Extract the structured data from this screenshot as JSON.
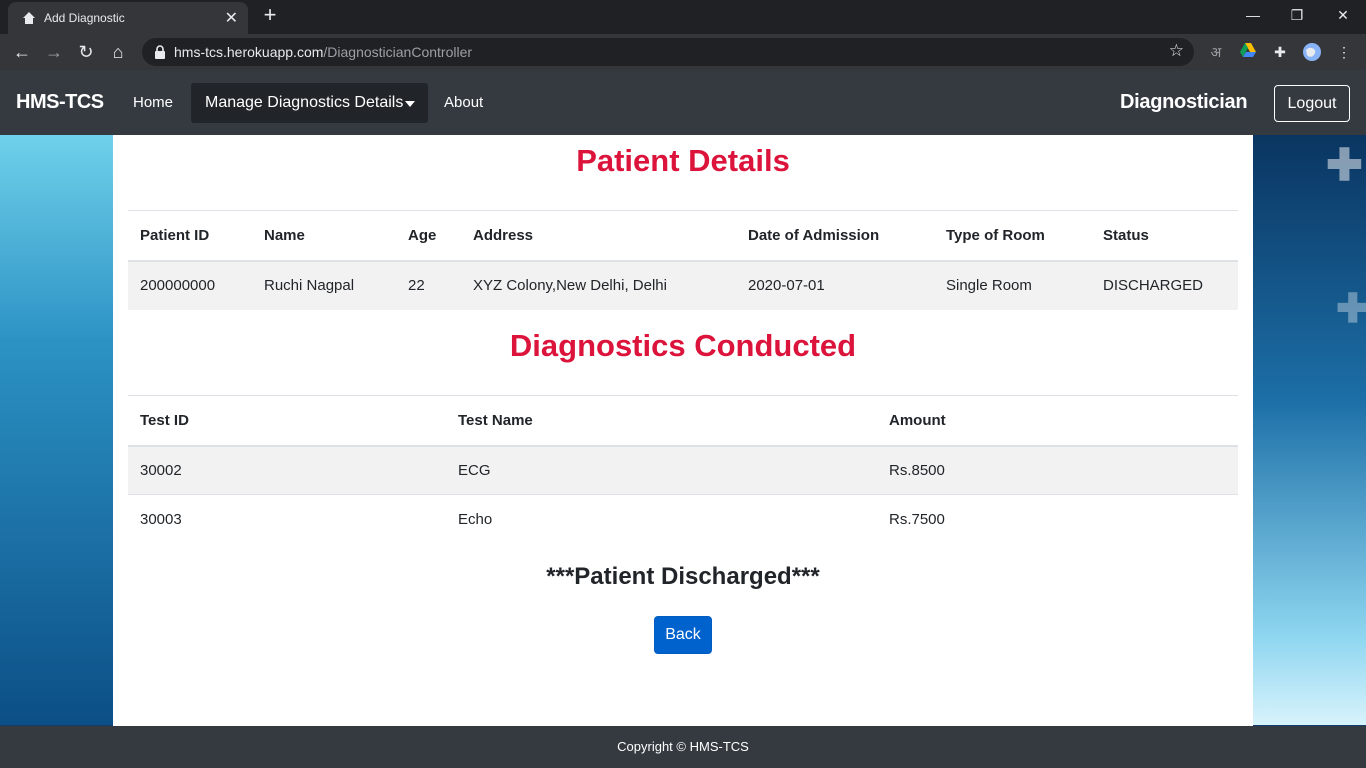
{
  "browser": {
    "tab_title": "Add Diagnostic",
    "url_host": "hms-tcs.herokuapp.com",
    "url_path": "/DiagnosticianController"
  },
  "nav": {
    "brand": "HMS-TCS",
    "home": "Home",
    "manage": "Manage Diagnostics Details",
    "about": "About",
    "role": "Diagnostician",
    "logout": "Logout"
  },
  "patient": {
    "heading": "Patient Details",
    "columns": [
      "Patient ID",
      "Name",
      "Age",
      "Address",
      "Date of Admission",
      "Type of Room",
      "Status"
    ],
    "row": [
      "200000000",
      "Ruchi Nagpal",
      "22",
      "XYZ Colony,New Delhi, Delhi",
      "2020-07-01",
      "Single Room",
      "DISCHARGED"
    ]
  },
  "diagnostics": {
    "heading": "Diagnostics Conducted",
    "columns": [
      "Test ID",
      "Test Name",
      "Amount"
    ],
    "rows": [
      [
        "30002",
        "ECG",
        "Rs.8500"
      ],
      [
        "30003",
        "Echo",
        "Rs.7500"
      ]
    ]
  },
  "status_message": "***Patient Discharged***",
  "back_button": "Back",
  "footer": "Copyright © HMS-TCS",
  "colors": {
    "heading_red": "#dc143c",
    "button_blue": "#0062cc",
    "navbar": "#343a40"
  }
}
